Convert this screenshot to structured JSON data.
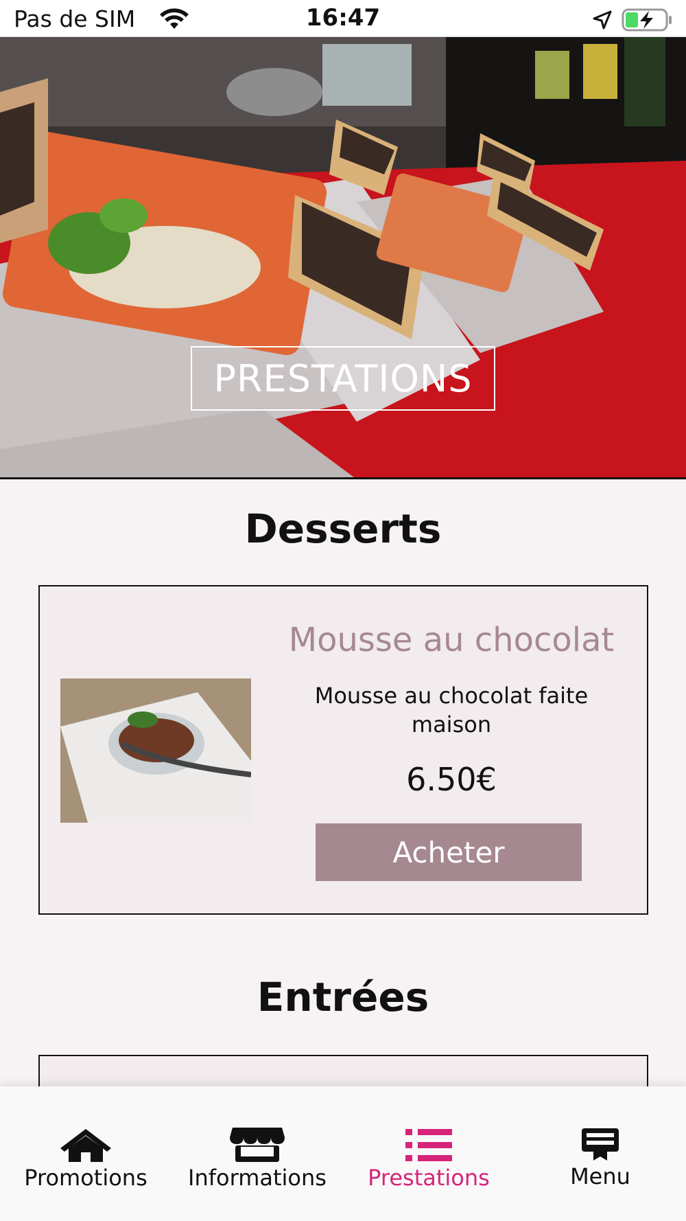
{
  "status_bar": {
    "carrier": "Pas de SIM",
    "time": "16:47",
    "wifi_icon": "wifi-icon",
    "location_icon": "location-arrow-icon",
    "battery_icon": "battery-charging-icon"
  },
  "hero": {
    "title": "PRESTATIONS"
  },
  "sections": [
    {
      "title": "Desserts",
      "item": {
        "name": "Mousse au chocolat",
        "description": "Mousse au chocolat faite maison",
        "price": "6.50€",
        "button_label": "Acheter"
      }
    },
    {
      "title": "Entrées"
    }
  ],
  "tab_bar": {
    "active_color": "#d6247a",
    "tabs": [
      {
        "label": "Promotions",
        "icon": "home-icon"
      },
      {
        "label": "Informations",
        "icon": "store-icon"
      },
      {
        "label": "Prestations",
        "icon": "list-icon"
      },
      {
        "label": "Menu",
        "icon": "menu-board-icon"
      }
    ]
  },
  "colors": {
    "accent": "#a68990",
    "background": "#f7f3f4",
    "card": "#f3ecee"
  }
}
